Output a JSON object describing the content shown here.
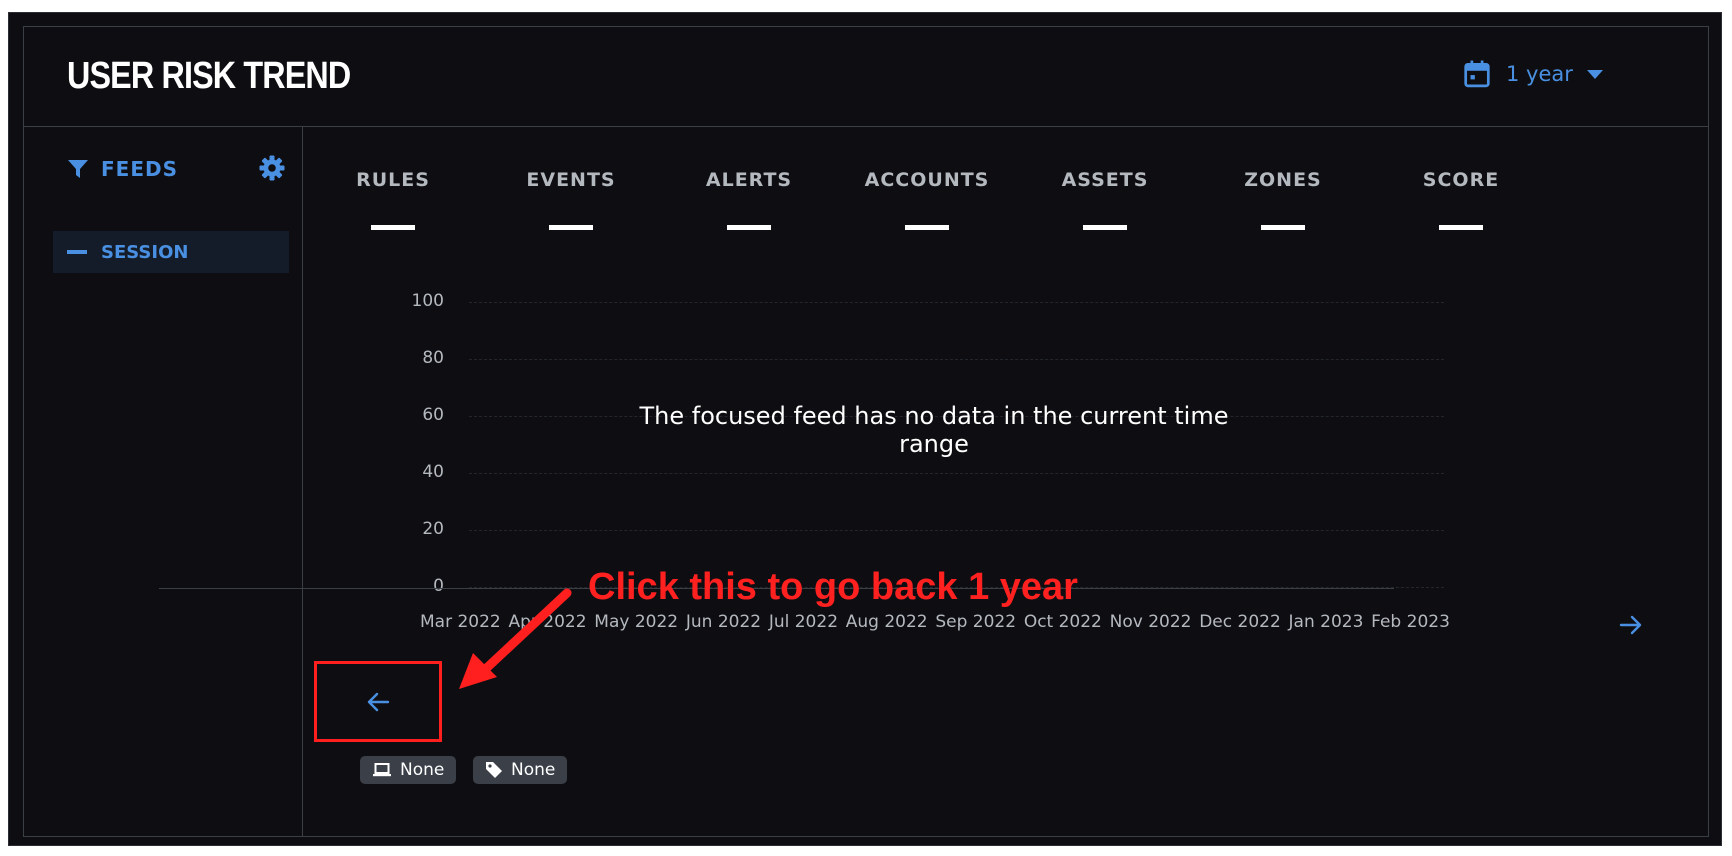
{
  "header": {
    "title": "USER RISK TREND",
    "range_label": "1 year"
  },
  "sidebar": {
    "feeds_label": "FEEDS",
    "items": [
      {
        "label": "SESSION"
      }
    ]
  },
  "stats": [
    {
      "label": "RULES",
      "value": ""
    },
    {
      "label": "EVENTS",
      "value": ""
    },
    {
      "label": "ALERTS",
      "value": ""
    },
    {
      "label": "ACCOUNTS",
      "value": ""
    },
    {
      "label": "ASSETS",
      "value": ""
    },
    {
      "label": "ZONES",
      "value": ""
    },
    {
      "label": "SCORE",
      "value": ""
    }
  ],
  "chart_data": {
    "type": "line",
    "categories": [
      "Mar 2022",
      "Apr 2022",
      "May 2022",
      "Jun 2022",
      "Jul 2022",
      "Aug 2022",
      "Sep 2022",
      "Oct 2022",
      "Nov 2022",
      "Dec 2022",
      "Jan 2023",
      "Feb 2023"
    ],
    "series": [],
    "yticks": [
      "100",
      "80",
      "60",
      "40",
      "20",
      "0"
    ],
    "ylim": [
      0,
      100
    ],
    "grid": true,
    "message": "The focused feed has no data in the current time range"
  },
  "chips": [
    {
      "icon": "laptop-icon",
      "label": "None"
    },
    {
      "icon": "tag-icon",
      "label": "None"
    }
  ],
  "annotation": {
    "text": "Click this to go back 1 year",
    "color": "#ff1f1f"
  },
  "colors": {
    "accent": "#4a90e2",
    "background": "#0e0e12"
  }
}
